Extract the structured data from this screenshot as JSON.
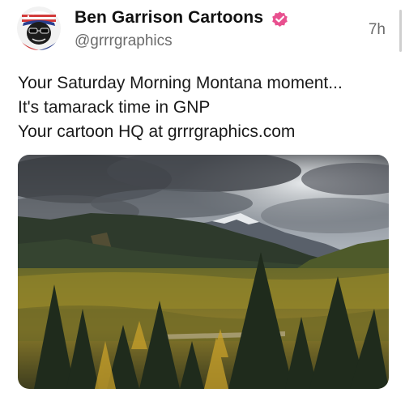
{
  "post": {
    "author": {
      "display_name": "Ben Garrison Cartoons",
      "handle": "@grrrgraphics",
      "verified_badge_icon": "verified-badge-icon",
      "avatar_icon": "avatar-cartoon-face"
    },
    "timestamp": "7h",
    "text_lines": [
      "Your Saturday Morning Montana moment...",
      "It's tamarack time in GNP",
      "Your cartoon HQ at grrrgraphics.com"
    ],
    "media": {
      "type": "photo",
      "subject_icon": "landscape-photo"
    }
  },
  "colors": {
    "verified_badge": "#e8508f",
    "name_text": "#111111",
    "secondary_text": "#6b6b6b",
    "body_text": "#1a1a1a"
  }
}
